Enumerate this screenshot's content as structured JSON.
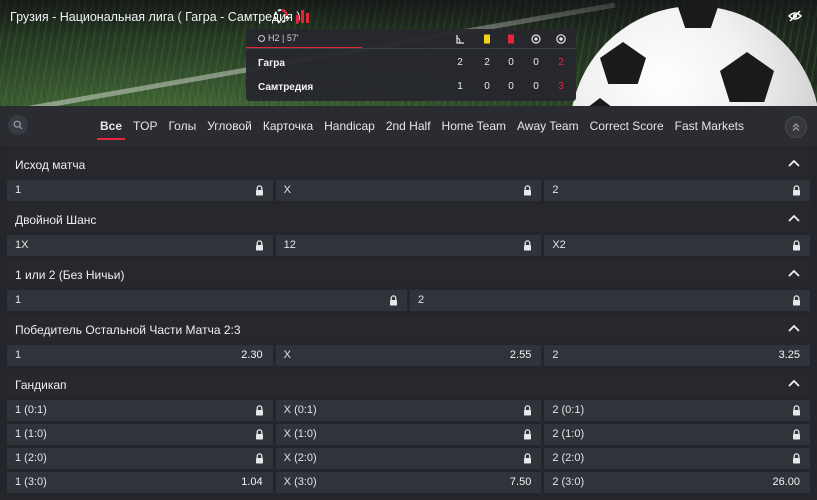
{
  "header": {
    "league_title": "Грузия - Национальная лига ( Гагра - Самтредия )",
    "period": "H2 | 57'",
    "columns": [
      "corner-icon",
      "yellow-card-icon",
      "red-card-icon",
      "penalty-icon",
      "ball-icon"
    ],
    "colors": {
      "accent": "#e4263a",
      "yellow": "#f2d31b",
      "red": "#e4263a"
    },
    "teams": [
      {
        "name": "Гагра",
        "stats": [
          "2",
          "2",
          "0",
          "0"
        ],
        "score": "2"
      },
      {
        "name": "Самтредия",
        "stats": [
          "1",
          "0",
          "0",
          "0"
        ],
        "score": "3"
      }
    ]
  },
  "tabs": [
    "Все",
    "TOP",
    "Голы",
    "Угловой",
    "Карточка",
    "Handicap",
    "2nd Half",
    "Home Team",
    "Away Team",
    "Correct Score",
    "Fast Markets"
  ],
  "active_tab": "Все",
  "markets": [
    {
      "title": "Исход матча",
      "rows": [
        [
          {
            "label": "1",
            "odds": "",
            "locked": true
          },
          {
            "label": "X",
            "odds": "",
            "locked": true
          },
          {
            "label": "2",
            "odds": "",
            "locked": true
          }
        ]
      ]
    },
    {
      "title": "Двойной Шанс",
      "rows": [
        [
          {
            "label": "1X",
            "odds": "",
            "locked": true
          },
          {
            "label": "12",
            "odds": "",
            "locked": true
          },
          {
            "label": "X2",
            "odds": "",
            "locked": true
          }
        ]
      ]
    },
    {
      "title": "1 или 2 (Без Ничьи)",
      "rows": [
        [
          {
            "label": "1",
            "odds": "",
            "locked": true
          },
          {
            "label": "2",
            "odds": "",
            "locked": true
          }
        ]
      ]
    },
    {
      "title": "Победитель Остальной Части Матча 2:3",
      "rows": [
        [
          {
            "label": "1",
            "odds": "2.30",
            "locked": false
          },
          {
            "label": "X",
            "odds": "2.55",
            "locked": false
          },
          {
            "label": "2",
            "odds": "3.25",
            "locked": false
          }
        ]
      ]
    },
    {
      "title": "Гандикап",
      "rows": [
        [
          {
            "label": "1  (0:1)",
            "odds": "",
            "locked": true
          },
          {
            "label": "X  (0:1)",
            "odds": "",
            "locked": true
          },
          {
            "label": "2  (0:1)",
            "odds": "",
            "locked": true
          }
        ],
        [
          {
            "label": "1  (1:0)",
            "odds": "",
            "locked": true
          },
          {
            "label": "X  (1:0)",
            "odds": "",
            "locked": true
          },
          {
            "label": "2  (1:0)",
            "odds": "",
            "locked": true
          }
        ],
        [
          {
            "label": "1  (2:0)",
            "odds": "",
            "locked": true
          },
          {
            "label": "X  (2:0)",
            "odds": "",
            "locked": true
          },
          {
            "label": "2  (2:0)",
            "odds": "",
            "locked": true
          }
        ],
        [
          {
            "label": "1  (3:0)",
            "odds": "1.04",
            "locked": false
          },
          {
            "label": "X  (3:0)",
            "odds": "7.50",
            "locked": false
          },
          {
            "label": "2  (3:0)",
            "odds": "26.00",
            "locked": false
          }
        ]
      ]
    }
  ]
}
